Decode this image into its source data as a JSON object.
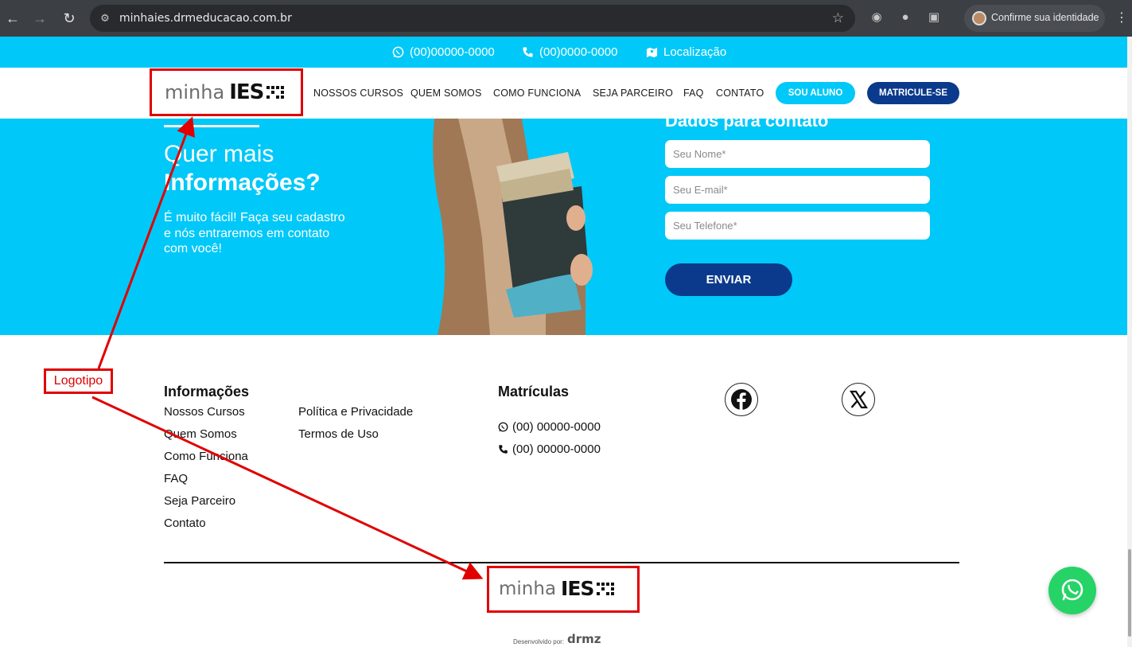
{
  "browser": {
    "url": "minhaies.drmeducacao.com.br",
    "profile_label": "Confirme sua identidade"
  },
  "topbar": {
    "whatsapp": "(00)00000-0000",
    "phone": "(00)0000-0000",
    "location": "Localização"
  },
  "header": {
    "logo_minha": "minha",
    "logo_ies": "IES",
    "nav": [
      "NOSSOS CURSOS",
      "QUEM SOMOS",
      "COMO FUNCIONA",
      "SEJA PARCEIRO",
      "FAQ",
      "CONTATO"
    ],
    "student_btn": "SOU ALUNO",
    "enroll_btn": "MATRICULE-SE"
  },
  "hero": {
    "title_light": "Quer mais",
    "title_bold": "Informações?",
    "text": "É muito fácil! Faça seu cadastro e nós entraremos em contato com você!",
    "form_title": "Dados para contato",
    "name_placeholder": "Seu Nome*",
    "email_placeholder": "Seu E-mail*",
    "phone_placeholder": "Seu Telefone*",
    "send_label": "ENVIAR"
  },
  "footer": {
    "info_title": "Informações",
    "info_links_col1": [
      "Nossos Cursos",
      "Quem Somos",
      "Como Funciona",
      "FAQ",
      "Seja Parceiro",
      "Contato"
    ],
    "info_links_col2": [
      "Política e Privacidade",
      "Termos de Uso"
    ],
    "enroll_title": "Matrículas",
    "enroll_whatsapp": "(00) 00000-0000",
    "enroll_phone": "(00) 00000-0000",
    "social": [
      "facebook-icon",
      "x-icon"
    ],
    "logo_minha": "minha",
    "logo_ies": "IES",
    "credit_small": "Desenvolvido por:",
    "credit_brand": "drmz"
  },
  "annotation": {
    "label": "Logotipo",
    "color": "#e00000"
  },
  "colors": {
    "primary_cyan": "#00c8f8",
    "navy": "#0b3a8c",
    "whatsapp_green": "#25d366"
  }
}
